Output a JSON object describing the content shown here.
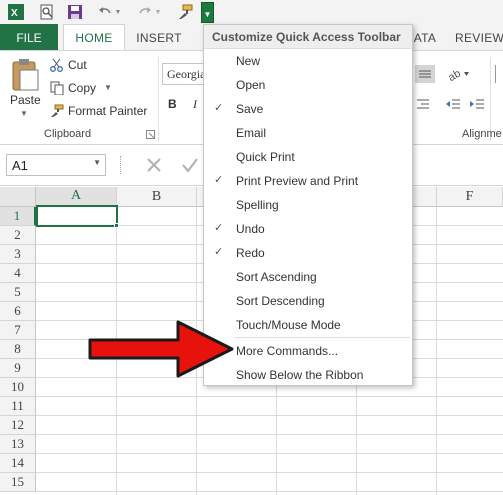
{
  "qat": {
    "buttons": [
      "excel-logo-icon",
      "print-preview-icon",
      "save-icon",
      "undo-icon",
      "redo-icon",
      "format-painter-icon"
    ],
    "dropdown_icon": "customize-dropdown-icon"
  },
  "tabs": {
    "file": "FILE",
    "home": "HOME",
    "insert": "INSERT",
    "data_partial": "ATA",
    "review_partial": "REVIEW"
  },
  "ribbon": {
    "paste": "Paste",
    "cut": "Cut",
    "copy": "Copy",
    "format_painter": "Format Painter",
    "clipboard_label": "Clipboard",
    "font_value": "Georgia",
    "bold": "B",
    "italic": "I",
    "alignment_label": "Alignme"
  },
  "formula_bar": {
    "name_box": "A1"
  },
  "grid": {
    "columns": [
      "A",
      "B",
      "F"
    ],
    "rows": [
      "1",
      "2",
      "3",
      "4",
      "5",
      "6",
      "7",
      "8",
      "9",
      "10",
      "11",
      "12",
      "13",
      "14",
      "15"
    ],
    "selected_cell": "A1"
  },
  "menu": {
    "title": "Customize Quick Access Toolbar",
    "items": [
      {
        "label": "New",
        "checked": false
      },
      {
        "label": "Open",
        "checked": false
      },
      {
        "label": "Save",
        "checked": true
      },
      {
        "label": "Email",
        "checked": false
      },
      {
        "label": "Quick Print",
        "checked": false
      },
      {
        "label": "Print Preview and Print",
        "checked": true
      },
      {
        "label": "Spelling",
        "checked": false
      },
      {
        "label": "Undo",
        "checked": true
      },
      {
        "label": "Redo",
        "checked": true
      },
      {
        "label": "Sort Ascending",
        "checked": false
      },
      {
        "label": "Sort Descending",
        "checked": false
      },
      {
        "label": "Touch/Mouse Mode",
        "checked": false
      },
      {
        "label": "More Commands...",
        "checked": false
      },
      {
        "label": "Show Below the Ribbon",
        "checked": false
      }
    ],
    "check_glyph": "✓"
  },
  "colors": {
    "excel_green": "#217346",
    "arrow_red": "#e8120c"
  }
}
